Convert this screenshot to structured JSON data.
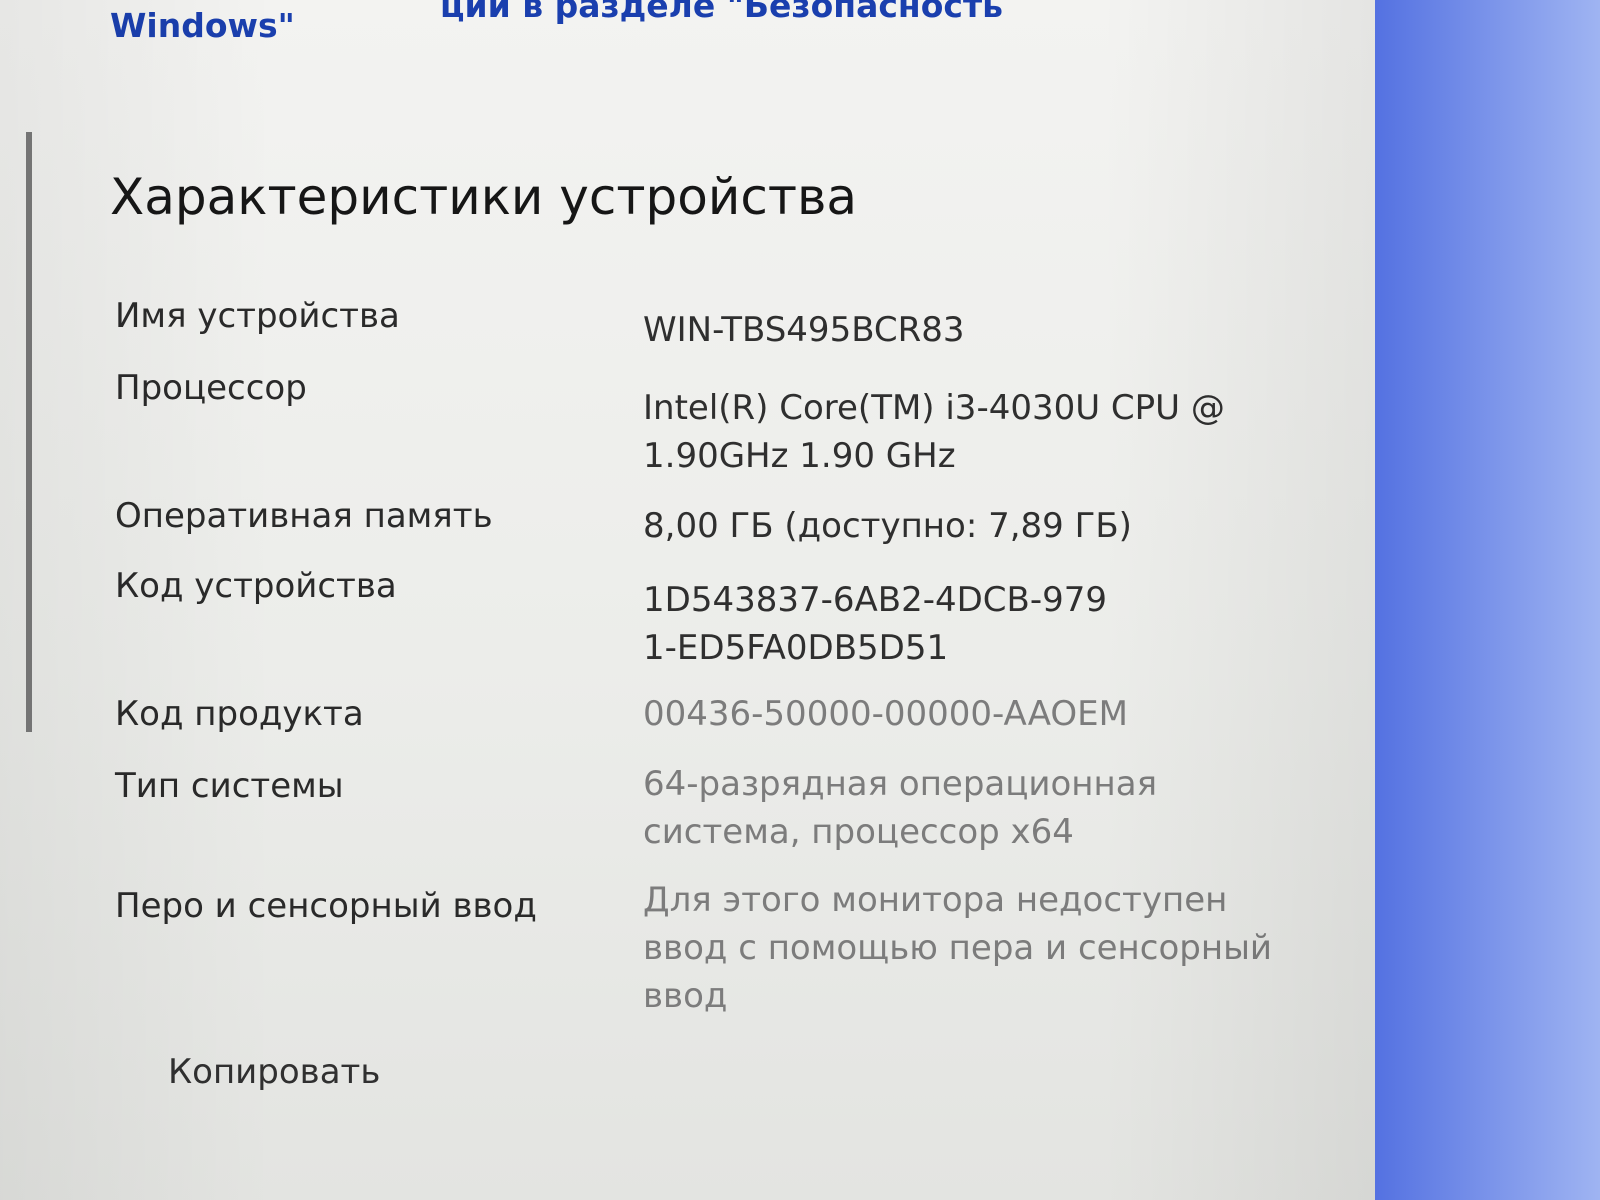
{
  "top_links": {
    "left": "Windows\"",
    "right": "ции в разделе \"Безопасность"
  },
  "section_title": "Характеристики устройства",
  "specs": [
    {
      "label": "Имя устройства",
      "value": "WIN-TBS495BCR83"
    },
    {
      "label": "Процессор",
      "value": "Intel(R) Core(TM) i3-4030U CPU @ 1.90GHz   1.90 GHz"
    },
    {
      "label": "Оперативная память",
      "value": "8,00 ГБ (доступно: 7,89 ГБ)"
    },
    {
      "label": "Код устройства",
      "value": "1D543837-6AB2-4DCB-9791-ED5FA0DB5D51"
    },
    {
      "label": "Код продукта",
      "value": "00436-50000-00000-AAOEM"
    },
    {
      "label": "Тип системы",
      "value": "64-разрядная операционная система, процессор x64"
    },
    {
      "label": "Перо и сенсорный ввод",
      "value": "Для этого монитора недоступен ввод с помощью пера и сенсорный ввод"
    }
  ],
  "copy_button_label": "Копировать",
  "colors": {
    "link": "#1a3fae",
    "desktop_background": "#1d2fbf"
  }
}
